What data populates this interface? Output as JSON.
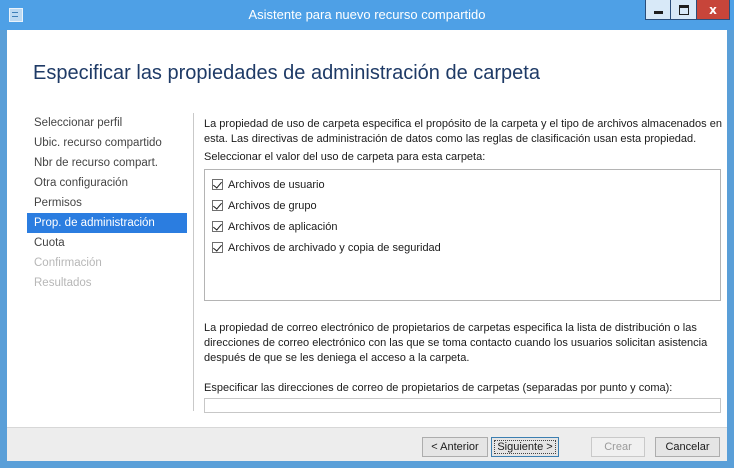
{
  "window": {
    "title": "Asistente para nuevo recurso compartido",
    "controls": {
      "minimize_icon": "minimize-icon",
      "maximize_icon": "maximize-icon",
      "close_glyph": "x"
    },
    "accent": "#2b7de0"
  },
  "page": {
    "title": "Especificar las propiedades de administración de carpeta"
  },
  "nav": {
    "items": [
      {
        "label": "Seleccionar perfil",
        "state": "normal"
      },
      {
        "label": "Ubic. recurso compartido",
        "state": "normal"
      },
      {
        "label": "Nbr de recurso compart.",
        "state": "normal"
      },
      {
        "label": "Otra configuración",
        "state": "normal"
      },
      {
        "label": "Permisos",
        "state": "normal"
      },
      {
        "label": "Prop. de administración",
        "state": "active"
      },
      {
        "label": "Cuota",
        "state": "normal"
      },
      {
        "label": "Confirmación",
        "state": "disabled"
      },
      {
        "label": "Resultados",
        "state": "disabled"
      }
    ]
  },
  "main": {
    "usage_description": "La propiedad de uso de carpeta especifica el propósito de la carpeta y el tipo de archivos almacenados en esta. Las directivas de administración de datos como las reglas de clasificación usan esta propiedad.",
    "usage_label": "Seleccionar el valor del uso de carpeta para esta carpeta:",
    "usage_options": [
      {
        "label": "Archivos de usuario",
        "checked": true
      },
      {
        "label": "Archivos de grupo",
        "checked": true
      },
      {
        "label": "Archivos de aplicación",
        "checked": true
      },
      {
        "label": "Archivos de archivado y copia de seguridad",
        "checked": true
      }
    ],
    "email_description": "La propiedad de correo electrónico de propietarios de carpetas especifica la lista de distribución o las direcciones de correo electrónico con las que se toma contacto cuando los usuarios solicitan asistencia después de que se les deniega el acceso a la carpeta.",
    "email_label": "Especificar las direcciones de correo de propietarios de carpetas (separadas por punto y coma):",
    "email_value": ""
  },
  "footer": {
    "back_label": "< Anterior",
    "next_label": "Siguiente >",
    "create_label": "Crear",
    "cancel_label": "Cancelar"
  }
}
